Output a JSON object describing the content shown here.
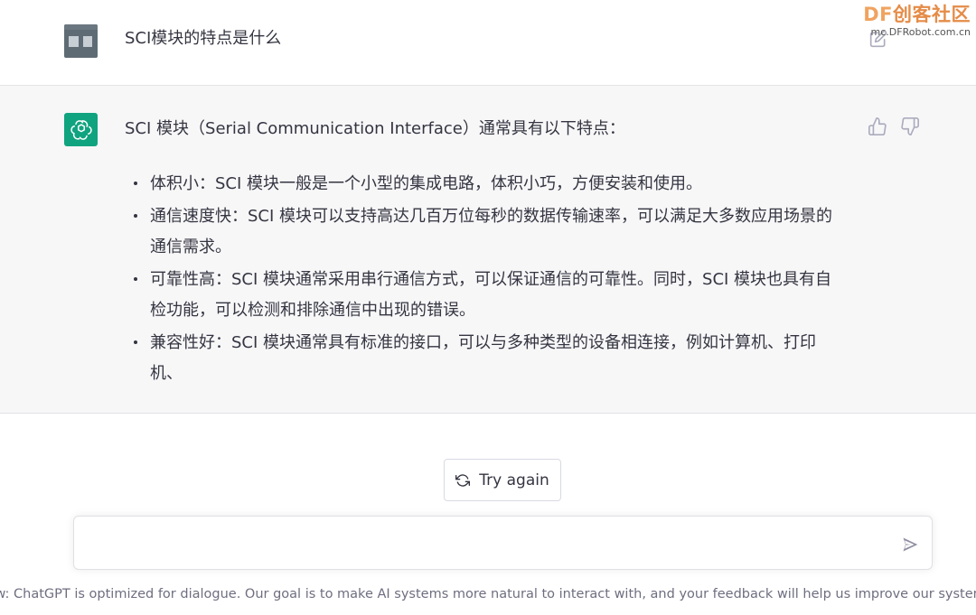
{
  "user_message": {
    "text": "SCI模块的特点是什么"
  },
  "watermark": {
    "brand_df": "DF",
    "brand_cn": "创客社区",
    "url": "mc.DFRobot.com.cn"
  },
  "assistant_message": {
    "intro": "SCI 模块（Serial Communication Interface）通常具有以下特点：",
    "bullets": [
      "体积小：SCI 模块一般是一个小型的集成电路，体积小巧，方便安装和使用。",
      "通信速度快：SCI 模块可以支持高达几百万位每秒的数据传输速率，可以满足大多数应用场景的通信需求。",
      "可靠性高：SCI 模块通常采用串行通信方式，可以保证通信的可靠性。同时，SCI 模块也具有自检功能，可以检测和排除通信中出现的错误。",
      "兼容性好：SCI 模块通常具有标准的接口，可以与多种类型的设备相连接，例如计算机、打印机、"
    ]
  },
  "actions": {
    "try_again_label": "Try again"
  },
  "composer": {
    "value": "",
    "placeholder": ""
  },
  "footer": {
    "text": "eview: ChatGPT is optimized for dialogue. Our goal is to make AI systems more natural to interact with, and your feedback will help us improve our systems"
  },
  "colors": {
    "assistant_bg": "#f7f7f8",
    "gpt_avatar": "#10a37f",
    "text": "#343541",
    "muted": "#6e6e80",
    "watermark_orange": "#e58c47"
  },
  "icons": {
    "user_avatar": "user-avatar",
    "edit": "edit-icon",
    "gpt_logo": "openai-logo-icon",
    "thumb_up": "thumbs-up-icon",
    "thumb_down": "thumbs-down-icon",
    "refresh": "refresh-icon",
    "send": "send-icon"
  }
}
